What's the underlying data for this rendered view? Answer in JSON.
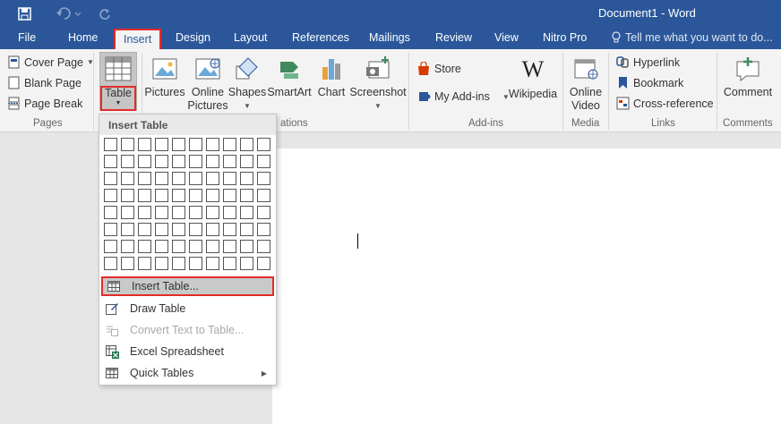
{
  "titlebar": {
    "document_title": "Document1 - Word",
    "qat": [
      "save-icon",
      "undo-icon",
      "redo-icon"
    ]
  },
  "tabs": {
    "file": "File",
    "home": "Home",
    "insert": "Insert",
    "design": "Design",
    "layout": "Layout",
    "references": "References",
    "mailings": "Mailings",
    "review": "Review",
    "view": "View",
    "nitro": "Nitro Pro",
    "tell_me": "Tell me what you want to do..."
  },
  "ribbon": {
    "pages": {
      "label": "Pages",
      "cover_page": "Cover Page",
      "blank_page": "Blank Page",
      "page_break": "Page Break"
    },
    "tables": {
      "table": "Table"
    },
    "illustrations": {
      "label": "ations",
      "pictures": "Pictures",
      "online_pictures_1": "Online",
      "online_pictures_2": "Pictures",
      "shapes": "Shapes",
      "smartart": "SmartArt",
      "chart": "Chart",
      "screenshot": "Screenshot"
    },
    "addins": {
      "label": "Add-ins",
      "store": "Store",
      "my_addins": "My Add-ins",
      "wikipedia": "Wikipedia"
    },
    "media": {
      "label": "Media",
      "online_video_1": "Online",
      "online_video_2": "Video"
    },
    "links": {
      "label": "Links",
      "hyperlink": "Hyperlink",
      "bookmark": "Bookmark",
      "cross_reference": "Cross-reference"
    },
    "comments": {
      "label": "Comments",
      "comment": "Comment"
    }
  },
  "dropdown": {
    "header": "Insert Table",
    "grid": {
      "columns": 10,
      "rows": 8
    },
    "items": [
      {
        "label": "Insert Table...",
        "icon": "insert-table-icon",
        "highlighted": true
      },
      {
        "label": "Draw Table",
        "icon": "draw-table-icon"
      },
      {
        "label": "Convert Text to Table...",
        "icon": "convert-text-icon",
        "disabled": true
      },
      {
        "label": "Excel Spreadsheet",
        "icon": "excel-spreadsheet-icon"
      },
      {
        "label": "Quick Tables",
        "icon": "quick-tables-icon",
        "submenu": true
      }
    ]
  },
  "colors": {
    "accent": "#2b579a",
    "highlight_border": "#e32b2b",
    "ribbon_bg": "#f3f3f3"
  }
}
